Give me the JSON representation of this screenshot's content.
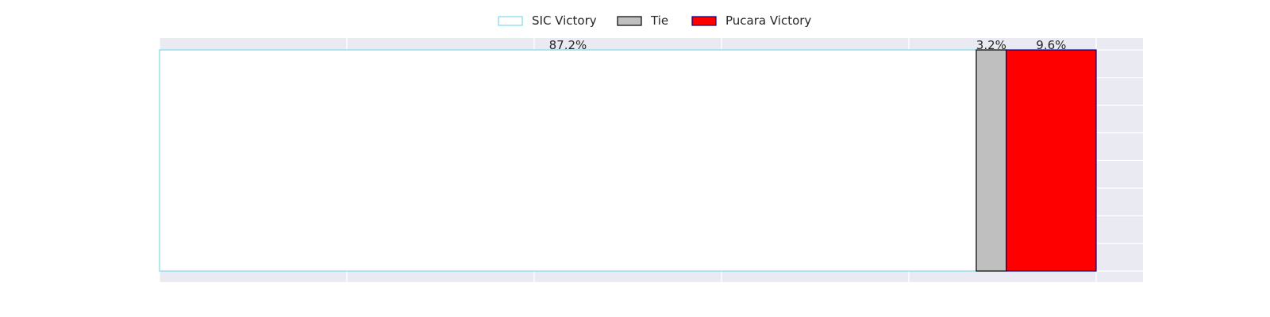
{
  "chart_data": {
    "type": "bar",
    "orientation": "horizontal",
    "stacked": true,
    "xlim": [
      0,
      105
    ],
    "grid": true,
    "legend_position": "top-center",
    "series": [
      {
        "name": "SIC Victory",
        "value": 87.2,
        "label": "87.2%",
        "fill": "#ffffff",
        "edge": "#7fd8e6"
      },
      {
        "name": "Tie",
        "value": 3.2,
        "label": "3.2%",
        "fill": "#bfbfbf",
        "edge": "#000000"
      },
      {
        "name": "Pucara Victory",
        "value": 9.6,
        "label": "9.6%",
        "fill": "#ff0000",
        "edge": "#00008b"
      }
    ],
    "colors": {
      "plot_background": "#eaeaf2",
      "grid": "#ffffff",
      "text": "#262626"
    }
  }
}
